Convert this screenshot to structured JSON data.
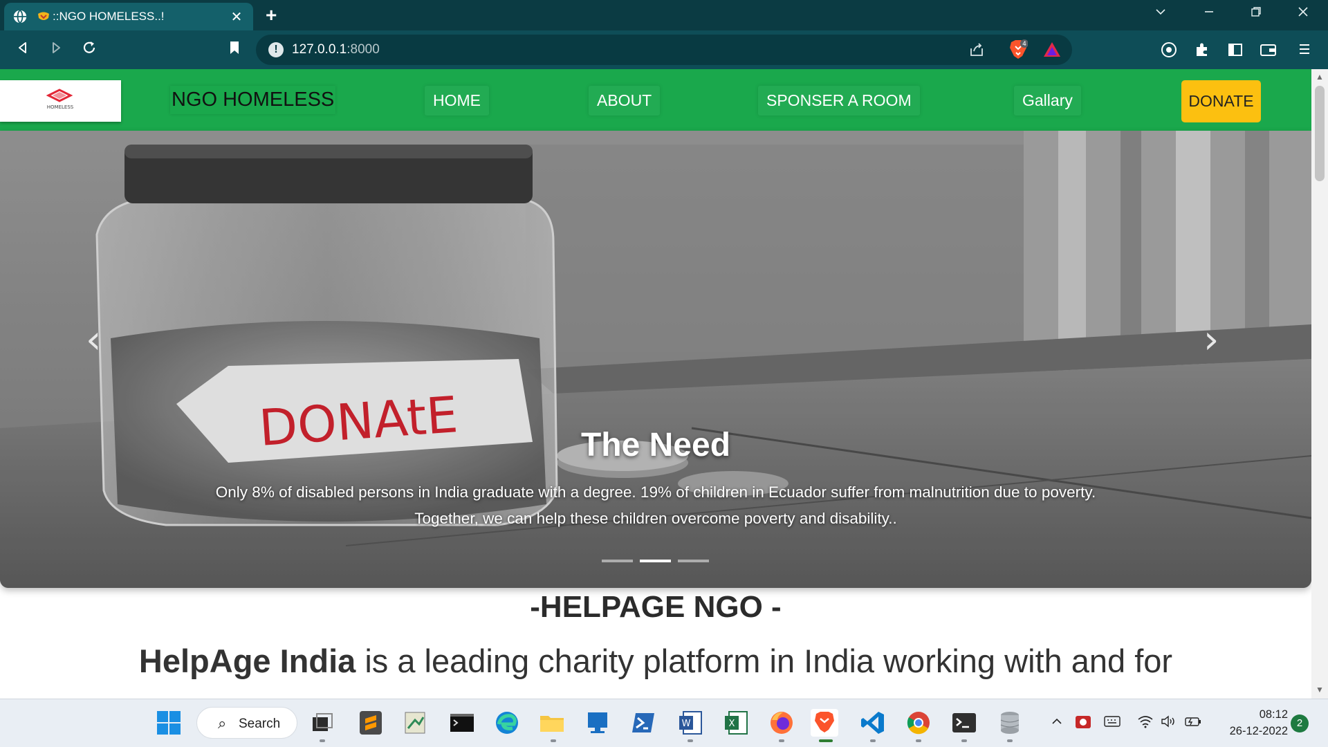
{
  "browser": {
    "tab_title": "::NGO HOMELESS..!",
    "tab_close": "✕",
    "new_tab": "+",
    "url_host": "127.0.0.1",
    "url_port": ":8000",
    "brave_badge": "4",
    "icons": [
      "globe-icon",
      "favicon-icon",
      "close-icon",
      "plus-icon",
      "chevron-down-icon",
      "minimize-icon",
      "restore-icon",
      "close-window-icon",
      "back-icon",
      "forward-icon",
      "reload-icon",
      "bookmark-icon",
      "info-icon",
      "share-icon",
      "brave-shield-icon",
      "brave-rewards-icon",
      "extension-vpn-icon",
      "puzzle-icon",
      "sidebar-icon",
      "wallet-icon",
      "menu-icon"
    ]
  },
  "site": {
    "logo_alt": "HOMELESS",
    "brand": "NGO HOMELESS",
    "nav": [
      {
        "label": "HOME"
      },
      {
        "label": "ABOUT"
      },
      {
        "label": "SPONSER A ROOM"
      },
      {
        "label": "Gallary"
      }
    ],
    "donate_label": "DONATE",
    "colors": {
      "navbar": "#1aa84c",
      "donate": "#fcc010"
    }
  },
  "carousel": {
    "prev_icon": "‹",
    "next_icon": "›",
    "caption_title": "The Need",
    "caption_text": "Only 8% of disabled persons in India graduate with a degree. 19% of children in Ecuador suffer from malnutrition due to poverty. Together, we can help these children overcome poverty and disability..",
    "jar_label": "DONAtE",
    "slide_count": 3,
    "active_slide": 2
  },
  "section": {
    "title": "-HELPAGE NGO -",
    "text_bold": "HelpAge India",
    "text_rest": " is a leading charity platform in India working with and for"
  },
  "taskbar": {
    "search_label": "Search",
    "time": "08:12",
    "date": "26-12-2022",
    "notification_count": "2",
    "apps": [
      "windows-start-icon",
      "task-view-icon",
      "sublime-text-icon",
      "notepadqq-icon",
      "terminal-icon",
      "edge-icon",
      "file-explorer-icon",
      "remote-desktop-icon",
      "powershell-icon",
      "word-icon",
      "excel-icon",
      "firefox-icon",
      "brave-icon",
      "vscode-icon",
      "chrome-icon",
      "windows-terminal-icon",
      "database-icon"
    ]
  }
}
